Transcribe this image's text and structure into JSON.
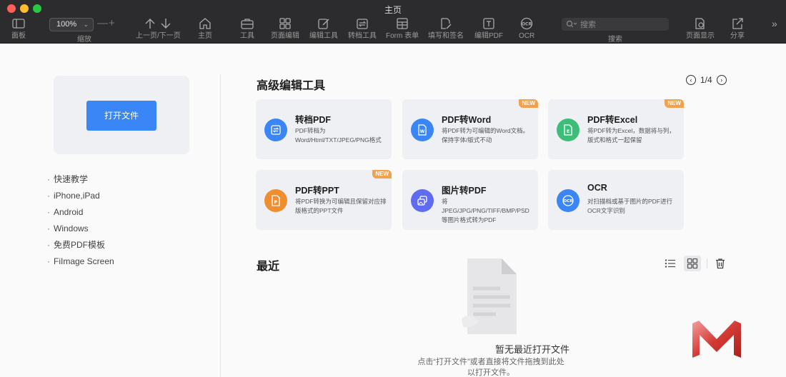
{
  "window": {
    "title": "主页"
  },
  "toolbar": {
    "panel": "面板",
    "zoom_value": "100%",
    "zoom_label": "缩放",
    "zoom_minus": "—",
    "zoom_plus": "+",
    "nav": "上一页/下一页",
    "home": "主页",
    "tools": "工具",
    "page_edit": "页面编辑",
    "edit_tool": "编辑工具",
    "convert_tool": "转档工具",
    "form": "Form 表单",
    "fill_sign": "填写和签名",
    "edit_pdf": "编辑PDF",
    "ocr": "OCR",
    "search_placeholder": "搜索",
    "search_label": "搜索",
    "page_display": "页面显示",
    "share": "分享",
    "more": "»"
  },
  "sidebar": {
    "open_button": "打开文件",
    "links": [
      "快速教学",
      "iPhone,iPad",
      "Android",
      "Windows",
      "免费PDF模板",
      "FiImage Screen"
    ]
  },
  "tools_section": {
    "title": "高级编辑工具",
    "pager": "1/4",
    "cards": [
      {
        "title": "转档PDF",
        "desc": "PDF转档为Word/Html/TXT/JPEG/PNG格式",
        "badge": "",
        "icon": "convert-icon",
        "color": "#3b86f7"
      },
      {
        "title": "PDF转Word",
        "desc": "将PDF转为可编辑的Word文档。保持字体/版式不动",
        "badge": "NEW",
        "icon": "word-icon",
        "color": "#3b86f7"
      },
      {
        "title": "PDF转Excel",
        "desc": "将PDF转为Excel，数据将与列，版式和格式一起保留",
        "badge": "NEW",
        "icon": "excel-icon",
        "color": "#3cbe7a"
      },
      {
        "title": "PDF转PPT",
        "desc": "将PDF转换为可编辑且保留对应排版格式的PPT文件",
        "badge": "NEW",
        "icon": "ppt-icon",
        "color": "#ef8e2f"
      },
      {
        "title": "图片转PDF",
        "desc": "将JPEG/JPG/PNG/TIFF/BMP/PSD等图片格式转为PDF",
        "badge": "",
        "icon": "image-icon",
        "color": "#5f6bf0"
      },
      {
        "title": "OCR",
        "desc": "对扫描档或基于图片的PDF进行OCR文字识别",
        "badge": "",
        "icon": "ocr-icon",
        "color": "#3b86f7"
      }
    ]
  },
  "recent": {
    "title": "最近",
    "empty_title": "暂无最近打开文件",
    "empty_desc": "点击“打开文件”或者直接将文件拖拽到此处以打开文件。"
  },
  "colors": {
    "accent": "#3b86f7",
    "badge": "#f5a04a",
    "toolbar_bg": "#2c2c2e"
  }
}
